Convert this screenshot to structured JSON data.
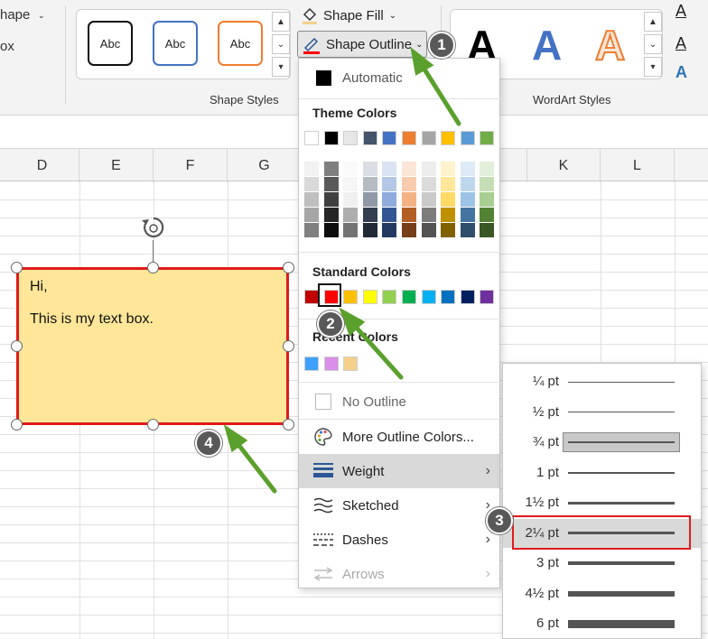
{
  "ribbon": {
    "shape_partial": "hape",
    "textbox_partial": "ox",
    "shape_styles_label": "Shape Styles",
    "style_samples": [
      "Abc",
      "Abc",
      "Abc"
    ],
    "shape_fill_label": "Shape Fill",
    "shape_outline_label": "Shape Outline",
    "wordart_label": "WordArt Styles",
    "wordart_letter": "A",
    "text_fill_letter": "A",
    "text_outline_letter": "A",
    "text_effects_letter": "A"
  },
  "columns": [
    "D",
    "E",
    "F",
    "G",
    "K",
    "L"
  ],
  "textbox": {
    "line1": "Hi,",
    "line2": "This is my text box."
  },
  "menu": {
    "automatic": "Automatic",
    "theme_colors": "Theme Colors",
    "standard_colors": "Standard Colors",
    "recent_colors": "Recent Colors",
    "no_outline": "No Outline",
    "more_colors": "More Outline Colors...",
    "weight": "Weight",
    "sketched": "Sketched",
    "dashes": "Dashes",
    "arrows": "Arrows",
    "theme_row": [
      "#ffffff",
      "#000000",
      "#e7e6e6",
      "#44546a",
      "#4472c4",
      "#ed7d31",
      "#a5a5a5",
      "#ffc000",
      "#5b9bd5",
      "#70ad47"
    ],
    "standard_row": [
      "#c00000",
      "#ff0000",
      "#ffc000",
      "#ffff00",
      "#92d050",
      "#00b050",
      "#00b0f0",
      "#0070c0",
      "#002060",
      "#7030a0"
    ],
    "recent_row": [
      "#3fa0ff",
      "#d98fe8",
      "#f5d08a"
    ],
    "selected_color": "#ff0000"
  },
  "weights": [
    {
      "label": "¼ pt"
    },
    {
      "label": "½ pt"
    },
    {
      "label": "¾ pt"
    },
    {
      "label": "1 pt"
    },
    {
      "label": "1½ pt"
    },
    {
      "label": "2¼ pt"
    },
    {
      "label": "3 pt"
    },
    {
      "label": "4½ pt"
    },
    {
      "label": "6 pt"
    }
  ],
  "callouts": [
    "1",
    "2",
    "3",
    "4"
  ],
  "colors": {
    "accent_arrow": "#5aa02c",
    "selection_red": "#e01b1b",
    "textbox_fill": "#ffe699"
  }
}
